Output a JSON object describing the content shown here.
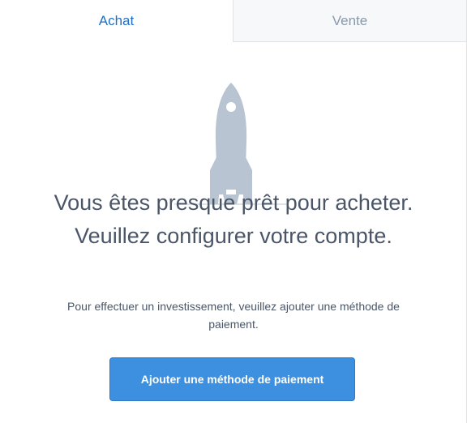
{
  "tabs": {
    "buy_label": "Achat",
    "sell_label": "Vente",
    "active": "buy"
  },
  "main": {
    "illustration_icon": "rocket-icon",
    "headline": "Vous êtes presque prêt pour acheter. Veuillez configurer votre compte.",
    "subtext": "Pour effectuer un investissement, veuillez ajouter une méthode de paiement.",
    "cta_label": "Ajouter une méthode de paiement"
  },
  "colors": {
    "accent": "#1f6fc5",
    "button": "#3d8fe0",
    "text": "#4a5668",
    "muted": "#8a99ab",
    "rocket": "#b9c4d3"
  }
}
